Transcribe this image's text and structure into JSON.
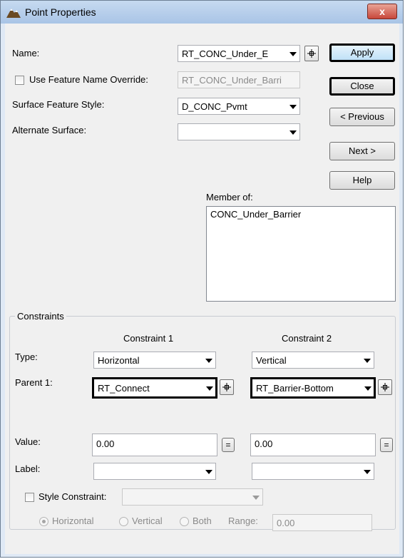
{
  "window": {
    "title": "Point Properties",
    "close_glyph": "x"
  },
  "fields": {
    "name_label": "Name:",
    "name_value": "RT_CONC_Under_E",
    "use_feature_override_label": "Use Feature Name Override:",
    "use_feature_override_value": "RT_CONC_Under_Barri",
    "surface_feature_style_label": "Surface Feature Style:",
    "surface_feature_style_value": "D_CONC_Pvmt",
    "alternate_surface_label": "Alternate Surface:",
    "alternate_surface_value": ""
  },
  "buttons": {
    "apply": "Apply",
    "close": "Close",
    "previous": "< Previous",
    "next": "Next >",
    "help": "Help"
  },
  "member_of": {
    "label": "Member of:",
    "items": [
      "CONC_Under_Barrier"
    ]
  },
  "constraints": {
    "group_label": "Constraints",
    "col1_header": "Constraint 1",
    "col2_header": "Constraint 2",
    "type_label": "Type:",
    "parent_label": "Parent 1:",
    "value_label": "Value:",
    "label_label": "Label:",
    "c1": {
      "type": "Horizontal",
      "parent": "RT_Connect",
      "value": "0.00",
      "label": ""
    },
    "c2": {
      "type": "Vertical",
      "parent": "RT_Barrier-Bottom",
      "value": "0.00",
      "label": ""
    },
    "eq_glyph": "="
  },
  "style_constraint": {
    "label": "Style Constraint:",
    "value": "",
    "options": [
      "Horizontal",
      "Vertical",
      "Both"
    ],
    "range_label": "Range:",
    "range_value": "0.00"
  }
}
